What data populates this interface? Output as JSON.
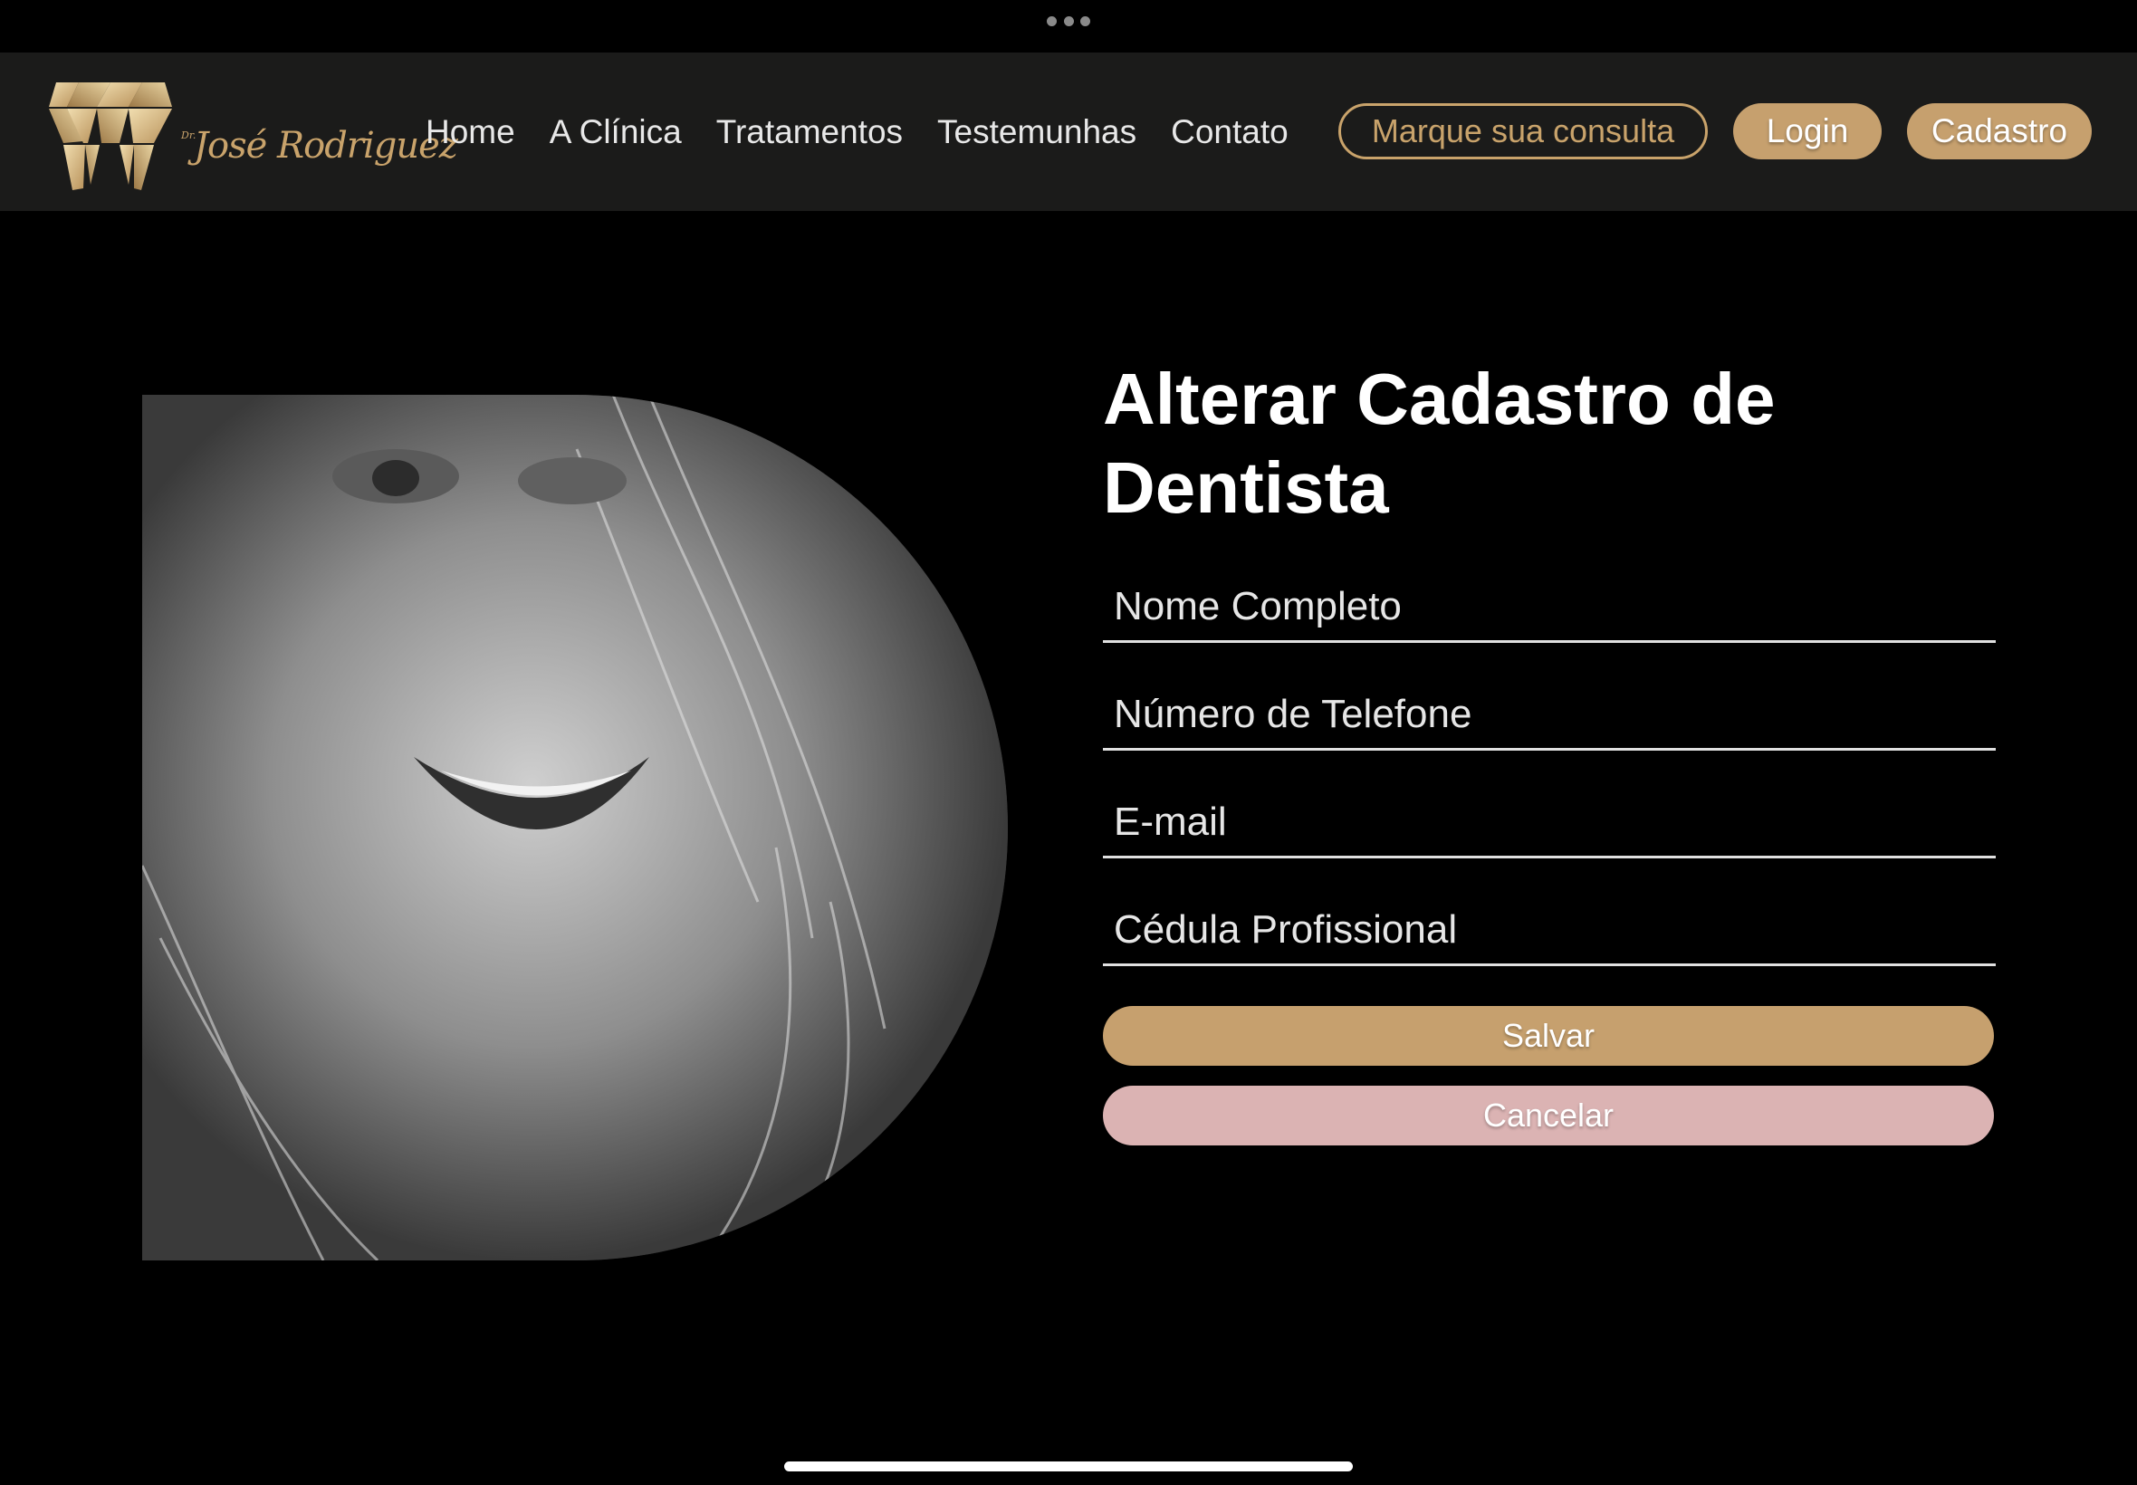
{
  "nav": {
    "logo_prefix": "Dr.",
    "logo_name": "José Rodriguez",
    "links": [
      "Home",
      "A Clínica",
      "Tratamentos",
      "Testemunhas",
      "Contato"
    ],
    "appointment_label": "Marque sua consulta",
    "login_label": "Login",
    "register_label": "Cadastro"
  },
  "form": {
    "title_line1": "Alterar Cadastro de",
    "title_line2": "Dentista",
    "fields": [
      {
        "placeholder": "Nome Completo"
      },
      {
        "placeholder": "Número de Telefone"
      },
      {
        "placeholder": "E-mail"
      },
      {
        "placeholder": "Cédula Profissional"
      }
    ],
    "save_label": "Salvar",
    "cancel_label": "Cancelar"
  },
  "colors": {
    "accent_gold": "#c6a06e",
    "cancel_pink": "#dbb3b3",
    "navbar_bg": "#1b1b1a",
    "page_bg": "#000000"
  },
  "icons": [
    "tooth-logo-icon",
    "multitask-dots-icon"
  ]
}
